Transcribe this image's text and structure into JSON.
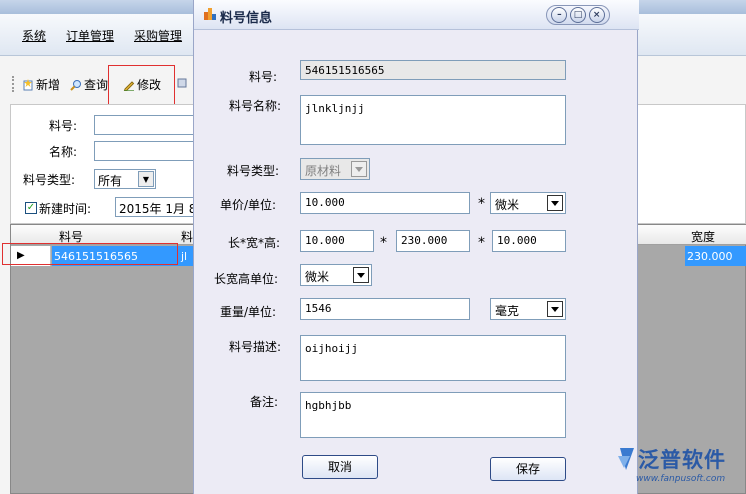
{
  "menu": [
    "系统",
    "订单管理",
    "采购管理"
  ],
  "toolbar": {
    "add_label": "新增",
    "query_label": "查询",
    "edit_label": "修改"
  },
  "search": {
    "material_no_label": "料号:",
    "name_label": "名称:",
    "type_label": "料号类型:",
    "type_value": "所有",
    "created_time_label": "新建时间:",
    "created_time_value": "2015年 1月 8"
  },
  "grid": {
    "col_material_no": "料号",
    "col_material_partial": "料",
    "col_width": "宽度",
    "row": {
      "material_no": "546151516565",
      "partial": "jl",
      "width": "230.000"
    }
  },
  "dialog": {
    "title": "料号信息",
    "fields": {
      "material_no_label": "料号:",
      "material_no": "546151516565",
      "name_label": "料号名称:",
      "name": "jlnkljnjj",
      "type_label": "料号类型:",
      "type": "原材料",
      "price_label": "单价/单位:",
      "price": "10.000",
      "price_unit": "微米",
      "dims_label": "长*宽*高:",
      "length": "10.000",
      "width": "230.000",
      "height": "10.000",
      "dims_unit_label": "长宽高单位:",
      "dims_unit": "微米",
      "weight_label": "重量/单位:",
      "weight": "1546",
      "weight_unit": "毫克",
      "desc_label": "料号描述:",
      "desc": "oijhoijj",
      "remark_label": "备注:",
      "remark": "hgbhjbb",
      "star": "*"
    },
    "cancel_label": "取消",
    "save_label": "保存"
  },
  "logo": {
    "text": "泛普软件",
    "url": "www.fanpusoft.com"
  }
}
